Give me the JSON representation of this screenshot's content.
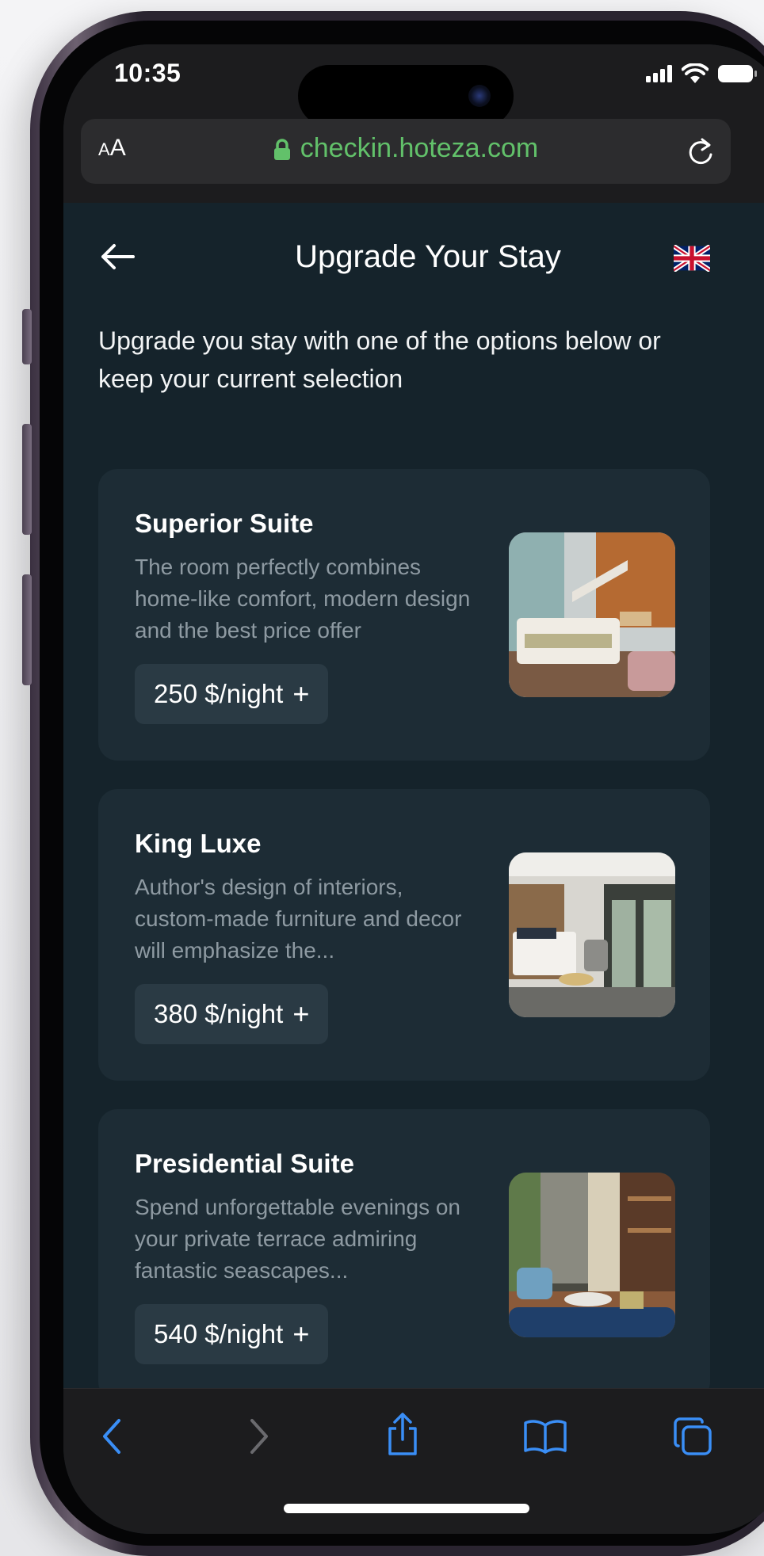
{
  "status_bar": {
    "time": "10:35"
  },
  "browser": {
    "text_size_label_small": "A",
    "text_size_label_large": "A",
    "url": "checkin.hoteza.com",
    "url_color": "#62c16a"
  },
  "page": {
    "title": "Upgrade Your Stay",
    "intro": "Upgrade you stay with one of the options below or keep your current selection",
    "rooms": [
      {
        "name": "Superior Suite",
        "description": "The room perfectly combines home-like comfort, modern design and the best price offer",
        "price": "250 $/night",
        "add_icon": "+"
      },
      {
        "name": "King Luxe",
        "description": "Author's design of interiors, custom-made furniture and decor will emphasize the...",
        "price": "380 $/night",
        "add_icon": "+"
      },
      {
        "name": "Presidential Suite",
        "description": "Spend unforgettable evenings on your private terrace admiring fantastic seascapes...",
        "price": "540 $/night",
        "add_icon": "+"
      }
    ]
  },
  "toolbar": {
    "icons": [
      "back-icon",
      "forward-icon",
      "share-icon",
      "bookmarks-icon",
      "tabs-icon"
    ],
    "accent": "#3a8ef6"
  },
  "colors": {
    "page_bg": "#15232b",
    "card_bg": "#1d2c35",
    "price_bg": "#2a3a44"
  }
}
